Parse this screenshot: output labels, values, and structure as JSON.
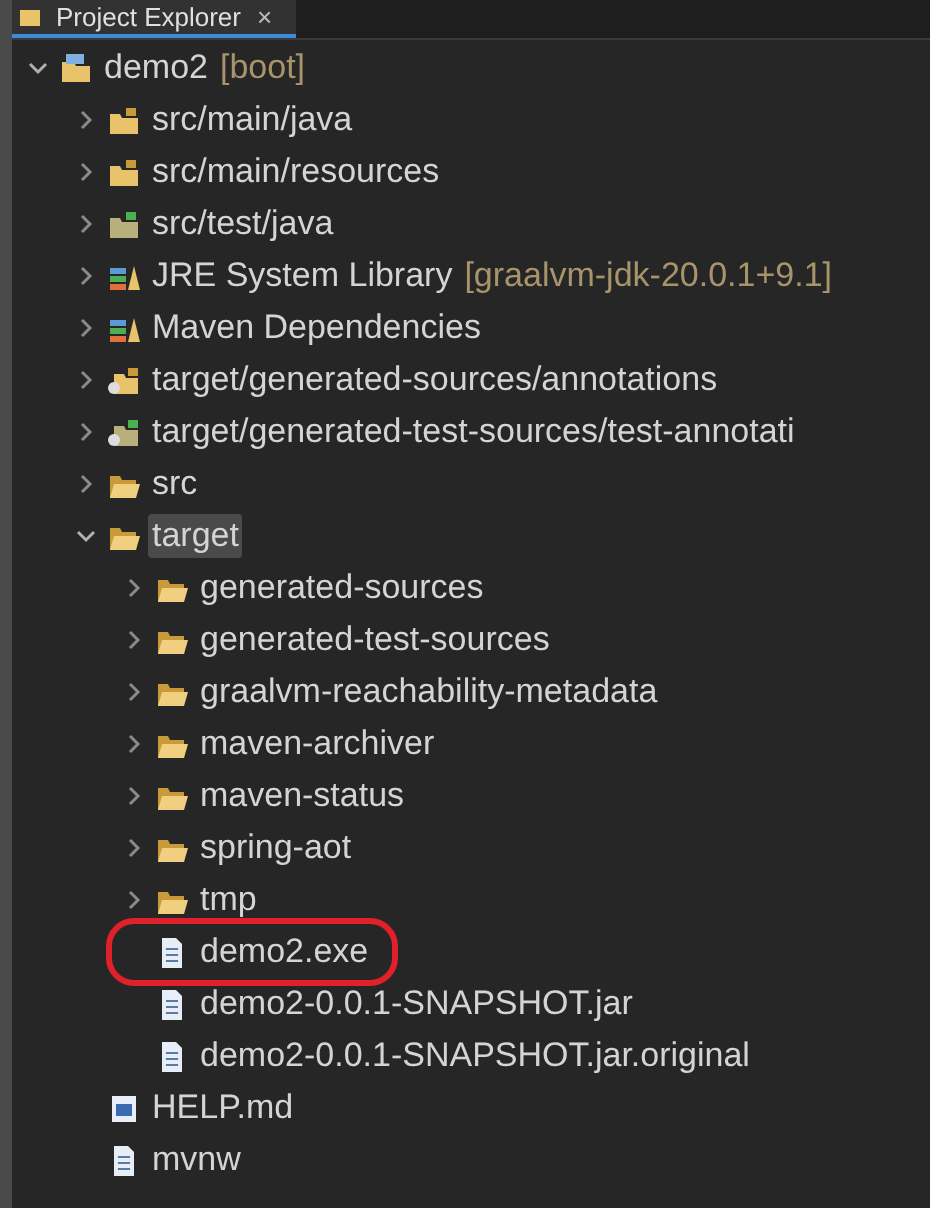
{
  "tab": {
    "title": "Project Explorer",
    "close": "×"
  },
  "tree": [
    {
      "label": "demo2",
      "decoration": "[boot]",
      "kind": "project",
      "expanded": true,
      "selected": false,
      "children": [
        {
          "label": "src/main/java",
          "kind": "source-folder",
          "expanded": false,
          "selected": false
        },
        {
          "label": "src/main/resources",
          "kind": "source-folder",
          "expanded": false,
          "selected": false
        },
        {
          "label": "src/test/java",
          "kind": "test-folder",
          "expanded": false,
          "selected": false
        },
        {
          "label": "JRE System Library",
          "decoration": "[graalvm-jdk-20.0.1+9.1]",
          "kind": "library",
          "expanded": false,
          "selected": false
        },
        {
          "label": "Maven Dependencies",
          "kind": "library",
          "expanded": false,
          "selected": false
        },
        {
          "label": "target/generated-sources/annotations",
          "kind": "generated-folder",
          "expanded": false,
          "selected": false
        },
        {
          "label": "target/generated-test-sources/test-annotati",
          "kind": "generated-test-folder",
          "expanded": false,
          "selected": false
        },
        {
          "label": "src",
          "kind": "folder",
          "expanded": false,
          "selected": false
        },
        {
          "label": "target",
          "kind": "folder",
          "expanded": true,
          "selected": true,
          "children": [
            {
              "label": "generated-sources",
              "kind": "folder",
              "expanded": false,
              "selected": false
            },
            {
              "label": "generated-test-sources",
              "kind": "folder",
              "expanded": false,
              "selected": false
            },
            {
              "label": "graalvm-reachability-metadata",
              "kind": "folder",
              "expanded": false,
              "selected": false
            },
            {
              "label": "maven-archiver",
              "kind": "folder",
              "expanded": false,
              "selected": false
            },
            {
              "label": "maven-status",
              "kind": "folder",
              "expanded": false,
              "selected": false
            },
            {
              "label": "spring-aot",
              "kind": "folder",
              "expanded": false,
              "selected": false
            },
            {
              "label": "tmp",
              "kind": "folder",
              "expanded": false,
              "selected": false
            },
            {
              "label": "demo2.exe",
              "kind": "file",
              "selected": false,
              "circled": true
            },
            {
              "label": "demo2-0.0.1-SNAPSHOT.jar",
              "kind": "file",
              "selected": false
            },
            {
              "label": "demo2-0.0.1-SNAPSHOT.jar.original",
              "kind": "file",
              "selected": false
            }
          ]
        },
        {
          "label": "HELP.md",
          "kind": "markdown",
          "selected": false
        },
        {
          "label": "mvnw",
          "kind": "file",
          "selected": false
        }
      ]
    }
  ]
}
